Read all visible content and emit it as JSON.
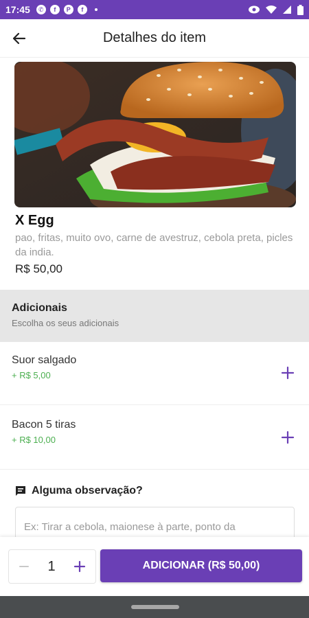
{
  "status_bar": {
    "time": "17:45",
    "icons": [
      "whatsapp-icon",
      "facebook-icon",
      "pinterest-icon",
      "facebook-icon"
    ],
    "right_icons": [
      "eye-icon",
      "wifi-icon",
      "signal-icon",
      "battery-icon"
    ]
  },
  "app_bar": {
    "title": "Detalhes do item",
    "back_icon": "arrow-left-icon"
  },
  "item": {
    "image_alt": "burger-photo",
    "name": "X Egg",
    "description": "pao, fritas, muito ovo, carne de avestruz, cebola preta, picles da india.",
    "price": "R$ 50,00"
  },
  "additionals": {
    "title": "Adicionais",
    "subtitle": "Escolha os seus adicionais",
    "items": [
      {
        "name": "Suor salgado",
        "price": "+ R$ 5,00"
      },
      {
        "name": "Bacon 5 tiras",
        "price": "+ R$ 10,00"
      }
    ]
  },
  "observation": {
    "title": "Alguma observação?",
    "placeholder": "Ex: Tirar a cebola, maionese à parte, ponto da"
  },
  "footer": {
    "quantity": "1",
    "add_button_label": "ADICIONAR (R$ 50,00)"
  },
  "colors": {
    "primary": "#6a3fb5",
    "price_green": "#4caf50",
    "section_bg": "#e6e6e6"
  }
}
